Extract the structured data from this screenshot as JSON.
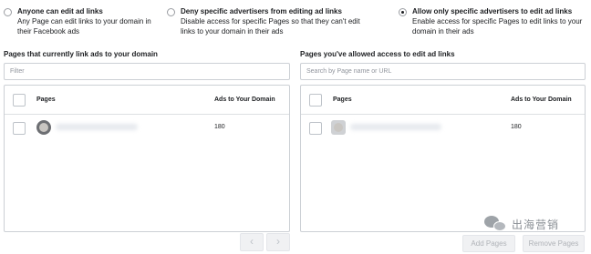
{
  "options": [
    {
      "title": "Anyone can edit ad links",
      "desc": "Any Page can edit links to your domain in their Facebook ads",
      "selected": false
    },
    {
      "title": "Deny specific advertisers from editing ad links",
      "desc": "Disable access for specific Pages so that they can't edit links to your domain in their ads",
      "selected": false
    },
    {
      "title": "Allow only specific advertisers to edit ad links",
      "desc": "Enable access for specific Pages to edit links to your domain in their ads",
      "selected": true
    }
  ],
  "left_panel": {
    "title": "Pages that currently link ads to your domain",
    "search_placeholder": "Filter",
    "col_pages": "Pages",
    "col_ads": "Ads to Your Domain",
    "rows": [
      {
        "ads": "180"
      }
    ]
  },
  "right_panel": {
    "title": "Pages you've allowed access to edit ad links",
    "search_placeholder": "Search by Page name or URL",
    "col_pages": "Pages",
    "col_ads": "Ads to Your Domain",
    "rows": [
      {
        "ads": "180"
      }
    ]
  },
  "pagination": {
    "prev_icon": "chevron-left-icon",
    "next_icon": "chevron-right-icon",
    "prev": "‹",
    "next": "›"
  },
  "actions": {
    "add": "Add Pages",
    "remove": "Remove Pages"
  },
  "watermark": {
    "text": "出海营销",
    "icon": "wechat-icon"
  }
}
